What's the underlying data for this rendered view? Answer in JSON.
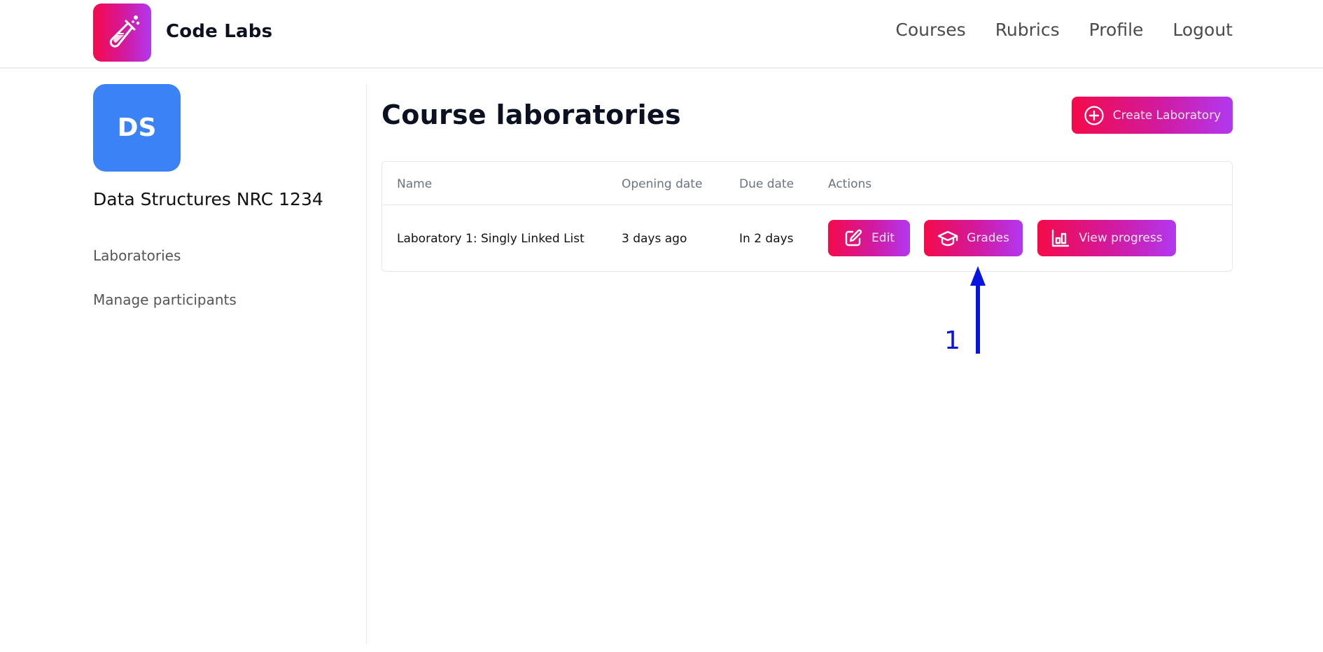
{
  "app": {
    "brand": "Code Labs",
    "logo_icon": "test-tube-icon"
  },
  "nav": {
    "links": [
      {
        "label": "Courses"
      },
      {
        "label": "Rubrics"
      },
      {
        "label": "Profile"
      },
      {
        "label": "Logout"
      }
    ]
  },
  "sidebar": {
    "avatar_initials": "DS",
    "avatar_color": "#3b82f6",
    "course_title": "Data Structures NRC 1234",
    "items": [
      {
        "label": "Laboratories"
      },
      {
        "label": "Manage participants"
      }
    ]
  },
  "main": {
    "title": "Course laboratories",
    "create_button": {
      "label": "Create Laboratory",
      "icon": "plus-circle-icon"
    },
    "table": {
      "columns": [
        "Name",
        "Opening date",
        "Due date",
        "Actions"
      ],
      "rows": [
        {
          "name": "Laboratory 1: Singly Linked List",
          "opening_date": "3 days ago",
          "due_date": "In 2 days",
          "actions": [
            {
              "label": "Edit",
              "icon": "edit-icon"
            },
            {
              "label": "Grades",
              "icon": "graduation-cap-icon"
            },
            {
              "label": "View progress",
              "icon": "bar-chart-icon"
            }
          ]
        }
      ]
    }
  },
  "annotation": {
    "label": "1",
    "color": "#0a14e0",
    "target": "Grades"
  },
  "colors": {
    "gradient_start": "#f50a4a",
    "gradient_end": "#b238f0"
  }
}
